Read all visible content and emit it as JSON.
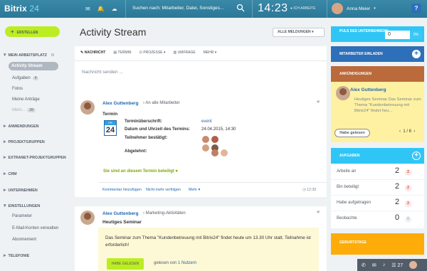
{
  "header": {
    "logo_main": "Bitrix",
    "logo_num": "24",
    "search_placeholder": "Suchen nach: Mitarbeiter, Datei, Sonstiges...",
    "time": "14:23",
    "work_status": "ICH ARBEITE",
    "user_name": "Anna Meier",
    "help": "?"
  },
  "sidebar": {
    "create": "ERSTELLEN",
    "my_workplace": "MEIN ARBEITSPLATZ",
    "active": "Activity Stream",
    "tasks": "Aufgaben",
    "tasks_count": "4",
    "photos": "Fotos",
    "requests": "Meine Anträge",
    "more": "Mehr...",
    "more_count": "28",
    "applications": "ANWENDUNGEN",
    "projects": "PROJEKTGRUPPEN",
    "extranet": "EXTRANET-PROJEKTGRUPPEN",
    "crm": "CRM",
    "company": "UNTERNEHMEN",
    "settings": "EINSTELLUNGEN",
    "parameters": "Parameter",
    "email_accounts": "E-Mail-Konten verwalten",
    "subscription": "Abonnement",
    "telephony": "TELEFONIE"
  },
  "main": {
    "title": "Activity Stream",
    "filter": "ALLE MELDUNGEN",
    "tabs": [
      "NACHRICHT",
      "TERMIN",
      "PROZESSE",
      "UMFRAGE",
      "MEHR"
    ],
    "composer_placeholder": "Nachricht senden ..."
  },
  "post1": {
    "author": "Alex Guttenberg",
    "to": "An alle Mitarbeiter",
    "type_title": "Termin",
    "cal_month": "FR",
    "cal_day": "24",
    "organizer_label": "Terminüberschrift:",
    "organizer_value": "event",
    "date_label": "Datum und Uhrzeit des Termins:",
    "date_value": "24.04.2015, 14:30",
    "confirmed_label": "Teilnehmer bestätigt:",
    "declined_label": "Abgelehnt:",
    "participate": "Sie sind an diesem Termin beteiligt",
    "comment": "Kommentar hinzufügen",
    "unfollow": "Nicht mehr verfolgen",
    "more": "Mehr",
    "time": "12:30"
  },
  "post2": {
    "author": "Alex Guttenberg",
    "to": "Marketing-Aktivitäten",
    "title": "Heutiges Seminar",
    "text": "Das Seminar zum Thema \"Kundenbetreuung mit Bitrix24\" findet heute um 13.30 Uhr statt. Teilnahme ist erforderlich!",
    "read_button": "Habe gelesen",
    "read_by": "gelesen von",
    "read_count": "1 Nutzern"
  },
  "right": {
    "pulse_title": "PULS DES UNTERNEHMENS",
    "pulse_value": "0",
    "pulse_pct": "0%",
    "invite": "MITARBEITER EINLADEN",
    "announcements": "ANKÜNDIGUNGEN",
    "ann_author": "Alex Guttenberg",
    "ann_text": "Heutiges Seminar Das Seminar zum Thema \"Kundenbetreuung mit Bitrix24\" findet heu...",
    "ann_button": "Habe gelesen",
    "ann_pager": "1 / 6",
    "tasks_title": "AUFGABEN",
    "task_rows": [
      {
        "label": "Arbeite an",
        "count": "2",
        "badge": "2"
      },
      {
        "label": "Bin beteiligt",
        "count": "2",
        "badge": "2"
      },
      {
        "label": "Habe aufgetragen",
        "count": "2",
        "badge": "2"
      },
      {
        "label": "Beobachte",
        "count": "0",
        "badge": "0"
      }
    ],
    "birthdays": "GEBURTSTAGE"
  },
  "bottombar": {
    "count": "27"
  }
}
